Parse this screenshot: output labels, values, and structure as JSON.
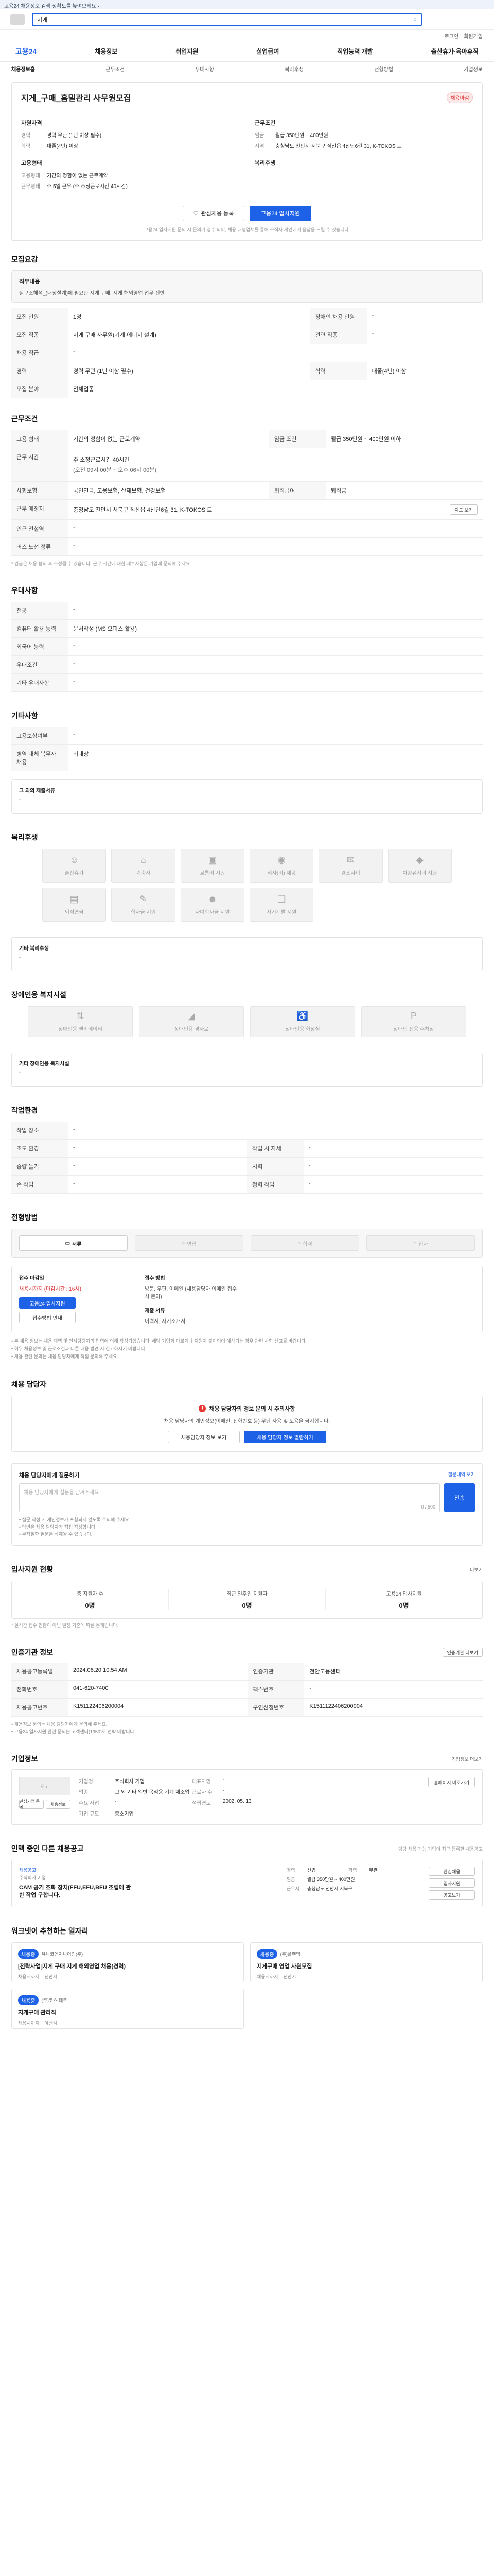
{
  "top_banner": {
    "text": "고용24 채용정보 검색 정확도를 높여보세요 ›"
  },
  "header": {
    "search_placeholder": "",
    "search_value": "지게",
    "login": "로그인",
    "signup": "회원가입"
  },
  "nav": {
    "items": [
      "고용24",
      "채용정보",
      "취업지원",
      "실업급여",
      "직업능력 개발",
      "출산휴가·육아휴직"
    ]
  },
  "subnav": {
    "items": [
      "채용정보홈",
      "근무조건",
      "우대사항",
      "복리후생",
      "전형방법",
      "기업정보"
    ]
  },
  "title_card": {
    "title": "지게_구매_홈밀관리 사무원모집",
    "badge": "채용마감",
    "left_heading": "자원자격",
    "left_rows": [
      {
        "k": "경력",
        "v": "경력 무관 (1년 이상 필수)"
      },
      {
        "k": "학력",
        "v": "대졸(4년) 이상"
      }
    ],
    "right_heading": "근무조건",
    "right_rows": [
      {
        "k": "임금",
        "v": "월급 350만원 ~ 400만원"
      },
      {
        "k": "지역",
        "v": "충청남도 천안시 서북구 직산읍 4산단6길 31, K-TOKOS 트"
      }
    ],
    "left_heading2": "고용형태",
    "left_rows2": [
      {
        "k": "고용형태",
        "v": "기간의 정함이 없는 근로계약"
      },
      {
        "k": "근무형태",
        "v": "주 5일 근무 (주 소정근로시간 40시간)"
      }
    ],
    "right_heading2": "복리후생",
    "right_rows2": [],
    "scrap_btn": "관심채용 등록",
    "apply_btn": "고용24 입사지원",
    "notice": "고용24 입사지원 문의 시 문의가 접수 되어, 채용 대행업체를 통해 구직자 개인에게 응답을 드릴 수 있습니다."
  },
  "recruit": {
    "title": "모집요강",
    "job_heading": "직무내용",
    "job_desc": "실구조해석_(내장설계)에 필요한 지게 구매, 지게 해외영업 업무 전반",
    "rows": [
      {
        "k1": "모집 인원",
        "v1": "1명",
        "k2": "장애인 채용 인원",
        "v2": "-"
      },
      {
        "k1": "모집 직종",
        "v1": "지게 구매 사무원(기계·에너지 설계)",
        "k2": "관련 직종",
        "v2": "-"
      },
      {
        "k1": "채용 직급",
        "v1": "-",
        "k2": "",
        "v2": ""
      },
      {
        "k1": "경력",
        "v1": "경력 무관 (1년 이상 필수)",
        "k2": "학력",
        "v2": "대졸(4년) 이상"
      },
      {
        "k1": "모집 분야",
        "v1": "전체업종",
        "k2": "",
        "v2": ""
      }
    ]
  },
  "conditions": {
    "title": "근무조건",
    "rows": [
      {
        "k1": "고용 형태",
        "v1": "기간의 정함이 없는 근로계약",
        "k2": "임금 조건",
        "v2": "월급 350만원 ~ 400만원 이하"
      },
      {
        "k1": "근무 시간",
        "v1": "주 소정근로시간 40시간",
        "k2": "",
        "v2": ""
      },
      {
        "k1": "",
        "v1": "(오전 09시 00분 ~ 오후 06시 00분)",
        "k2": "",
        "v2": ""
      },
      {
        "k1": "사회보험",
        "v1": "국민연금, 고용보험, 산재보험, 건강보험",
        "k2": "퇴직급여",
        "v2": "퇴직금"
      },
      {
        "k1": "근무 예정지",
        "v1": "충청남도 천안시 서북구 직산읍 4산단6길 31, K-TOKOS 트",
        "k2": "",
        "v2": ""
      },
      {
        "k1": "인근 전철역",
        "v1": "-",
        "k2": "",
        "v2": ""
      },
      {
        "k1": "버스 노선 정류",
        "v1": "-",
        "k2": "",
        "v2": ""
      }
    ],
    "map_btn": "지도 보기",
    "note": "* 임금은 채용 협의 후 조정될 수 있습니다. 근무 시간에 대한 세부사항은 기업에 문의해 주세요."
  },
  "preference": {
    "title": "우대사항",
    "rows": [
      {
        "k": "전공",
        "v": "-"
      },
      {
        "k": "컴퓨터 활용 능력",
        "v": "문서작성 (MS 오피스 활용)"
      },
      {
        "k": "외국어 능력",
        "v": "-"
      },
      {
        "k": "우대조건",
        "v": "-"
      },
      {
        "k": "기타 우대사항",
        "v": "-"
      }
    ]
  },
  "etc": {
    "title": "기타사항",
    "rows": [
      {
        "k": "고용보험여부",
        "v": "-"
      },
      {
        "k": "병역 대체 복무자 채용",
        "v": "비대상"
      }
    ],
    "other_heading": "그 외의 제출서류",
    "other_value": "-"
  },
  "welfare": {
    "title": "복리후생",
    "items": [
      "출산휴가",
      "기숙사",
      "교통비 지원",
      "식사(비) 제공",
      "경조사비",
      "차량유지비 지원",
      "퇴직연금",
      "학자금 지원",
      "자녀학자금 지원",
      "자기계발 지원"
    ],
    "other_heading": "기타 복리후생",
    "other_value": "-"
  },
  "disability": {
    "title": "장애인용 복지시설",
    "items": [
      "장애인용 엘리베이터",
      "장애인용 경사로",
      "장애인용 화장실",
      "장애인 전용 주차장"
    ],
    "other_heading": "기타 장애인용 복지시설",
    "other_value": "-"
  },
  "work_env": {
    "title": "작업환경",
    "rows": [
      {
        "k1": "작업 장소",
        "v1": "-",
        "k2": "",
        "v2": ""
      },
      {
        "k1": "조도 환경",
        "v1": "-",
        "k2": "작업 시 자세",
        "v2": "-"
      },
      {
        "k1": "중량 들기",
        "v1": "-",
        "k2": "시력",
        "v2": "-"
      },
      {
        "k1": "손 작업",
        "v1": "-",
        "k2": "청력 작업",
        "v2": "-"
      }
    ]
  },
  "selection": {
    "title": "전형방법",
    "steps": [
      "서류",
      "면접",
      "합격",
      "입사"
    ],
    "apply_heading": "접수 마감일",
    "apply_value": "채용시까지 (마감시간 : 16시)",
    "apply_btn1": "고용24 입사지원",
    "apply_btn2": "접수방법 안내",
    "method_heading": "접수 방법",
    "method_value": "방문, 우편, 이메일 (채용담당자 이메일 접수 시 문의)",
    "docs_heading": "제출 서류",
    "docs_value": "이력서, 자기소개서",
    "notes": [
      "• 본 채용 정보는 채용 대행 및 인사담당자의 입력에 의해 작성되었습니다. 해당 기업과 다르거나 지원자 불이익이 예상되는 경우 관련 사항 신고를 바랍니다.",
      "• 허위 채용정보 및 근로조건과 다른 내용 발견 시 신고하시기 바랍니다.",
      "• 채용 관련 문의는 채용 담당자에게 직접 문의해 주세요."
    ]
  },
  "contact": {
    "title": "채용 담당자",
    "warn_title": "채용 담당자의 정보 문의 시 주의사항",
    "warn_text": "채용 담당자의 개인정보(이메일, 전화번호 등) 무단 사용 및 도용을 금지합니다.",
    "btn1": "채용담당자 정보 보기",
    "btn2": "채용 담당자 정보 열람하기"
  },
  "inquiry": {
    "title": "채용 담당자에게 질문하기",
    "count_label": "0 / 500",
    "placeholder": "채용 담당자에게 질문을 남겨주세요.",
    "submit": "전송",
    "notes": [
      "• 질문 작성 시 개인정보가 포함되지 않도록 주의해 주세요.",
      "• 답변은 채용 담당자가 직접 작성합니다.",
      "• 부적절한 질문은 삭제될 수 있습니다."
    ],
    "more_btn": "질문내역 보기"
  },
  "applicants": {
    "title": "입사지원 현황",
    "more": "더보기",
    "stats": [
      {
        "label": "총 지원자 수",
        "value": "0명"
      },
      {
        "label": "최근 일주일 지원자",
        "value": "0명"
      },
      {
        "label": "고용24 입사지원",
        "value": "0명"
      }
    ],
    "note": "* 실시간 접수 현황이 아닌 일정 기준에 따른 통계입니다."
  },
  "org_info": {
    "title": "인증기관 정보",
    "more": "인증기관 더보기",
    "rows": [
      {
        "k1": "채용공고등록일",
        "v1": "2024.06.20 10:54 AM",
        "k2": "인증기관",
        "v2": "천안고용센터"
      },
      {
        "k1": "전화번호",
        "v1": "041-620-7400",
        "k2": "팩스번호",
        "v2": "-"
      },
      {
        "k1": "채용공고번호",
        "v1": "K151122406200004",
        "k2": "구인신청번호",
        "v2": "K1511122406200004"
      }
    ],
    "notes": [
      "• 채용정보 문의는 채용 담당자에게 문의해 주세요.",
      "• 고용24 입사지원 관련 문의는 고객센터(1350)로 연락 바랍니다."
    ]
  },
  "company": {
    "title": "기업정보",
    "more": "기업정보 더보기",
    "logo_alt": "로고",
    "rows": [
      {
        "k1": "기업명",
        "v1": "주식회사 기업",
        "k2": "대표자명",
        "v2": "-"
      },
      {
        "k1": "업종",
        "v1": "그 외 기타 일반 목적용 기계 제조업",
        "k2": "근로자 수",
        "v2": "-"
      },
      {
        "k1": "주요 사업",
        "v1": "-",
        "k2": "설립연도",
        "v2": "2002. 05. 13"
      },
      {
        "k1": "기업 규모",
        "v1": "중소기업",
        "k2": "",
        "v2": ""
      }
    ],
    "btn1": "관심기업 등록",
    "btn2": "채용정보",
    "page_btn": "홈페이지 바로가기"
  },
  "similar": {
    "title": "인맥 중인 다른 채용공고",
    "note": "담당 채용 가능 기업이 최근 등록한 채용공고",
    "company_tag": "채용공고",
    "company": "주식회사 기업",
    "job": "CAM 공기 조화 장치(FFU,EFU,BFU 조립에 관한 작업 구합니다.",
    "info": [
      {
        "k": "경력",
        "v": "신입"
      },
      {
        "k": "학력",
        "v": "무관"
      },
      {
        "k": "임금",
        "v": "월급 350만원 ~ 400만원"
      },
      {
        "k": "근무지",
        "v": "충청남도 천안시 서북구"
      }
    ],
    "btns": [
      "관심채용",
      "입사지원",
      "공고보기"
    ]
  },
  "recommend": {
    "title": "워크넷이 추천하는 일자리",
    "items": [
      {
        "tag": "채용중",
        "company": "유니코엔지니어링(주)",
        "job": "[전략사업]지게 구매 지게 해외영업 채용(경력)",
        "deadline": "채용시까지",
        "loc": "천안시"
      },
      {
        "tag": "채용중",
        "company": "(주)플랜텍",
        "job": "지게구매 영업 사원모집",
        "deadline": "채용시까지",
        "loc": "천안시"
      },
      {
        "tag": "채용중",
        "company": "(주)코스 테크",
        "job": "지게구매 관리직",
        "deadline": "채용시까지",
        "loc": "아산시"
      }
    ]
  }
}
